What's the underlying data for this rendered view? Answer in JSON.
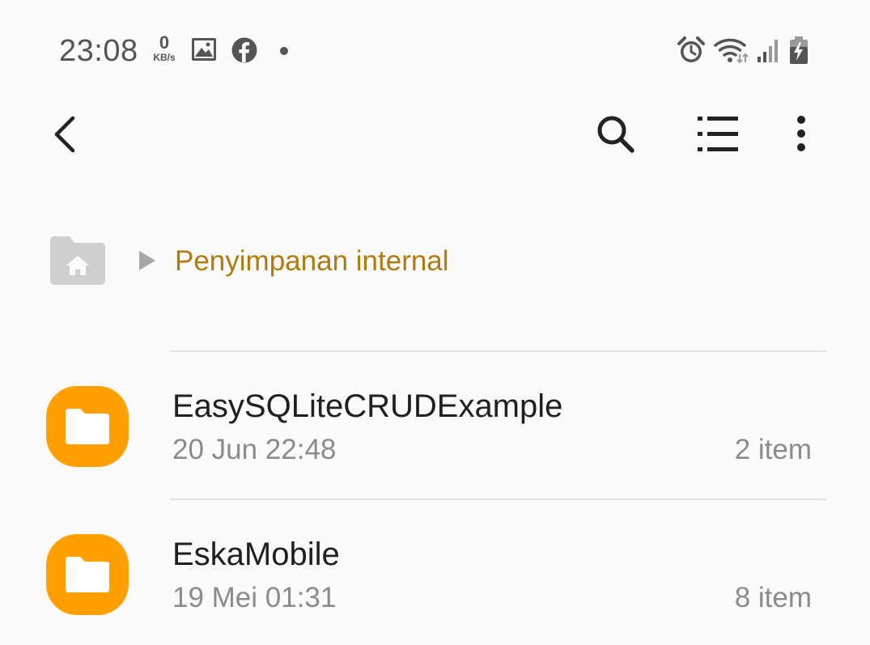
{
  "status_bar": {
    "time": "23:08",
    "net_speed_value": "0",
    "net_speed_unit": "KB/s",
    "icons": [
      "gallery-icon",
      "facebook-icon",
      "dot-icon",
      "alarm-icon",
      "wifi-icon",
      "signal-icon",
      "battery-charging-icon"
    ]
  },
  "toolbar": {
    "icons": [
      "back-icon",
      "search-icon",
      "list-view-icon",
      "more-options-icon"
    ]
  },
  "breadcrumb": {
    "label": "Penyimpanan internal",
    "accent_color": "#b07a0d",
    "icon": "home-folder-icon"
  },
  "files": [
    {
      "name": "EasySQLiteCRUDExample",
      "date": "20 Jun 22:48",
      "count": "2 item",
      "icon": "folder-icon"
    },
    {
      "name": "EskaMobile",
      "date": "19 Mei 01:31",
      "count": "8 item",
      "icon": "folder-icon"
    }
  ],
  "colors": {
    "folder": "#ffa000",
    "background": "#fafafa"
  }
}
